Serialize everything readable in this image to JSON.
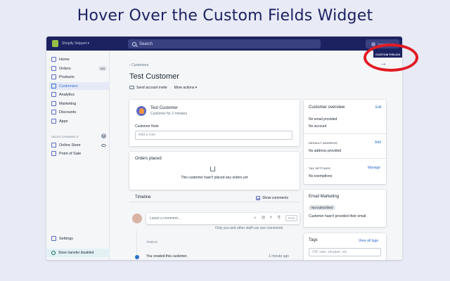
{
  "headline": "Hover Over the Custom Fields Widget",
  "topbar": {
    "store_name": "Shopify Snippet ▾",
    "search_placeholder": "Search",
    "account_label": "Cassie Flash",
    "custom_fields_label": "CUSTOM FIELDS"
  },
  "sidebar": {
    "items": [
      {
        "label": "Home",
        "icon": "home-icon"
      },
      {
        "label": "Orders",
        "icon": "orders-icon",
        "badge": "115"
      },
      {
        "label": "Products",
        "icon": "products-icon"
      },
      {
        "label": "Customers",
        "icon": "customers-icon",
        "active": true
      },
      {
        "label": "Analytics",
        "icon": "analytics-icon"
      },
      {
        "label": "Marketing",
        "icon": "marketing-icon"
      },
      {
        "label": "Discounts",
        "icon": "discounts-icon"
      },
      {
        "label": "Apps",
        "icon": "apps-icon"
      }
    ],
    "channels_heading": "SALES CHANNELS",
    "channels": [
      {
        "label": "Online Store",
        "icon": "store-icon"
      },
      {
        "label": "Point of Sale",
        "icon": "pos-icon"
      }
    ],
    "settings_label": "Settings",
    "transfer_label": "Store transfer disabled"
  },
  "main": {
    "breadcrumb": "Customers",
    "title": "Test Customer",
    "send_invite": "Send account invite",
    "more_actions": "More actions ▾",
    "customer_card": {
      "name": "Test Customer",
      "subtitle": "Customer for 2 minutes",
      "note_label": "Customer Note",
      "note_placeholder": "Add a note"
    },
    "orders_card": {
      "heading": "Orders placed",
      "empty_text": "This customer hasn't placed any orders yet"
    },
    "timeline": {
      "heading": "Timeline",
      "show_comments": "Show comments",
      "comment_placeholder": "Leave a comment...",
      "post_label": "Post",
      "visibility_note": "Only you and other staff can see comments",
      "today_label": "TODAY",
      "event_text": "You created this customer.",
      "event_time": "1 minute ago"
    }
  },
  "right": {
    "overview": {
      "heading": "Customer overview",
      "edit": "Edit",
      "email": "No email provided",
      "account": "No account",
      "address_heading": "DEFAULT ADDRESS",
      "address_link": "Add",
      "address_value": "No address provided",
      "tax_heading": "TAX SETTINGS",
      "tax_link": "Manage",
      "tax_value": "No exemptions"
    },
    "email_marketing": {
      "heading": "Email Marketing",
      "status": "Not subscribed",
      "note": "Customer hasn't provided their email."
    },
    "tags": {
      "heading": "Tags",
      "link": "View all tags",
      "placeholder": "VIP, sale, shopper, etc"
    }
  },
  "colors": {
    "topbar": "#1c2260",
    "accent": "#5c6ac4",
    "link": "#2c6ecb",
    "highlight": "#e11a22"
  }
}
